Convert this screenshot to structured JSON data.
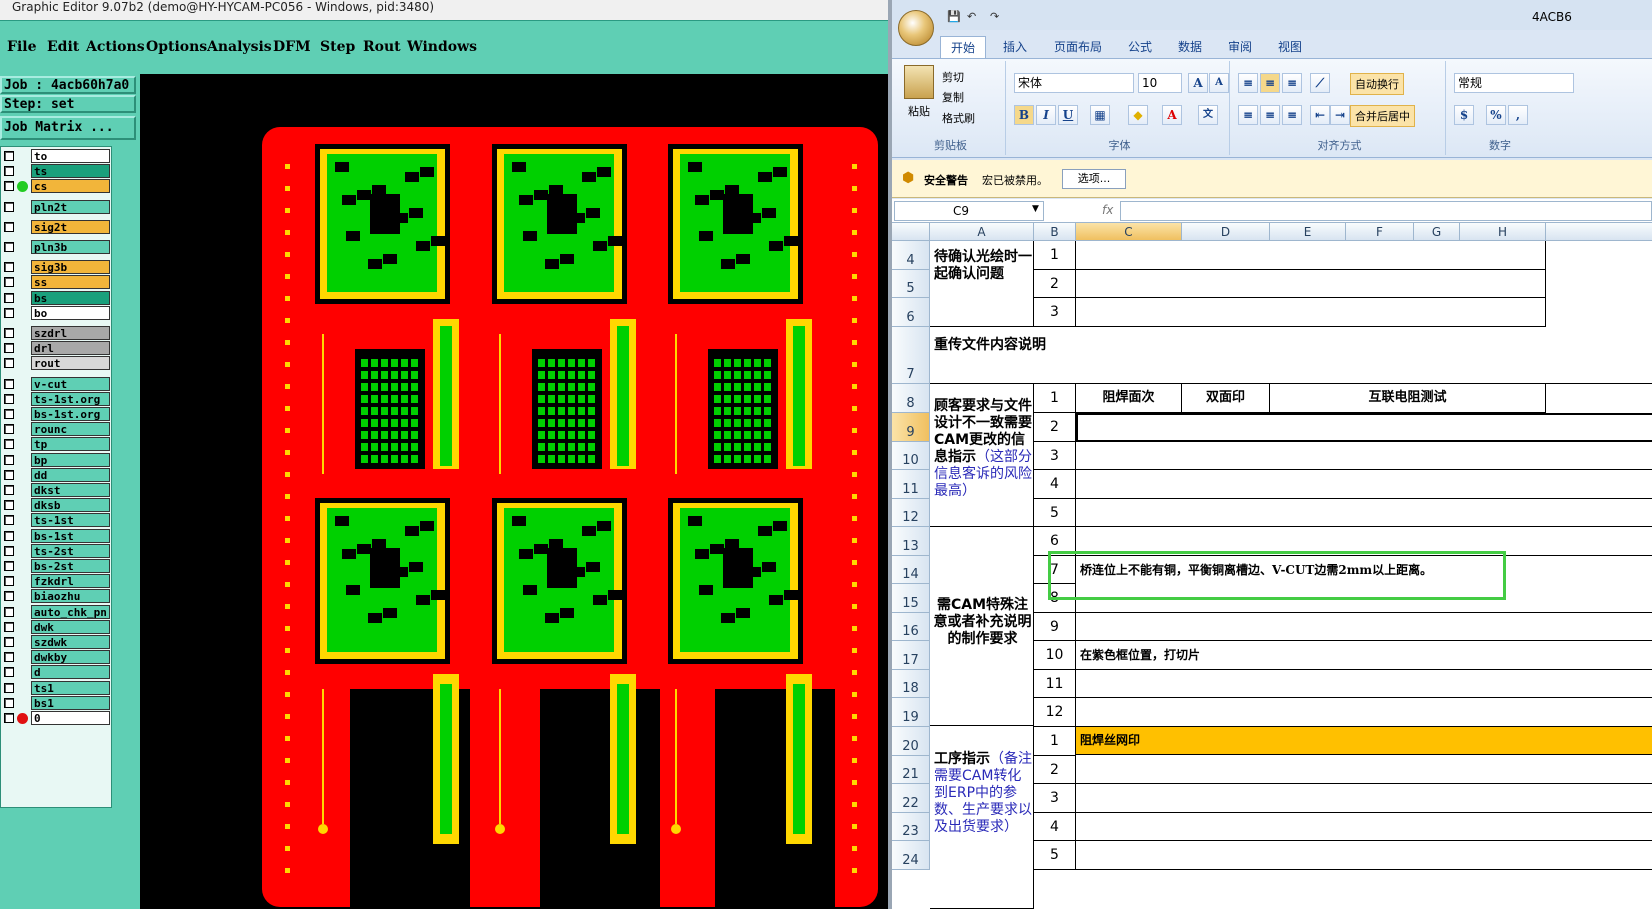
{
  "ge": {
    "title": "Graphic Editor 9.07b2 (demo@HY-HYCAM-PC056 - Windows, pid:3480)",
    "menu": [
      "File",
      "Edit",
      "Actions",
      "Options",
      "Analysis",
      "DFM",
      "Step",
      "Rout",
      "Windows"
    ],
    "job": "Job : 4acb60h7a0",
    "step": "Step: set",
    "matrix": "Job Matrix ...",
    "layers": [
      {
        "name": "to",
        "color": "#ffffff",
        "dot": ""
      },
      {
        "name": "ts",
        "color": "#1aa07c",
        "dot": ""
      },
      {
        "name": "cs",
        "color": "#f2b53a",
        "dot": "#22cc22"
      },
      {
        "name": "pln2t",
        "color": "#5fcfb4",
        "dot": ""
      },
      {
        "name": "sig2t",
        "color": "#f2b53a",
        "dot": ""
      },
      {
        "name": "pln3b",
        "color": "#5fcfb4",
        "dot": ""
      },
      {
        "name": "sig3b",
        "color": "#f2b53a",
        "dot": ""
      },
      {
        "name": "ss",
        "color": "#f2b53a",
        "dot": ""
      },
      {
        "name": "bs",
        "color": "#1aa07c",
        "dot": ""
      },
      {
        "name": "bo",
        "color": "#ffffff",
        "dot": ""
      },
      {
        "name": "szdrl",
        "color": "#a8a8a8",
        "dot": ""
      },
      {
        "name": "drl",
        "color": "#a8a8a8",
        "dot": ""
      },
      {
        "name": "rout",
        "color": "#d8d8d8",
        "dot": ""
      },
      {
        "name": "v-cut",
        "color": "#5fcfb4",
        "dot": ""
      },
      {
        "name": "ts-1st.org",
        "color": "#5fcfb4",
        "dot": ""
      },
      {
        "name": "bs-1st.org",
        "color": "#5fcfb4",
        "dot": ""
      },
      {
        "name": "rounc",
        "color": "#5fcfb4",
        "dot": ""
      },
      {
        "name": "tp",
        "color": "#5fcfb4",
        "dot": ""
      },
      {
        "name": "bp",
        "color": "#5fcfb4",
        "dot": ""
      },
      {
        "name": "dd",
        "color": "#5fcfb4",
        "dot": ""
      },
      {
        "name": "dkst",
        "color": "#5fcfb4",
        "dot": ""
      },
      {
        "name": "dksb",
        "color": "#5fcfb4",
        "dot": ""
      },
      {
        "name": "ts-1st",
        "color": "#5fcfb4",
        "dot": ""
      },
      {
        "name": "bs-1st",
        "color": "#5fcfb4",
        "dot": ""
      },
      {
        "name": "ts-2st",
        "color": "#5fcfb4",
        "dot": ""
      },
      {
        "name": "bs-2st",
        "color": "#5fcfb4",
        "dot": ""
      },
      {
        "name": "fzkdrl",
        "color": "#5fcfb4",
        "dot": ""
      },
      {
        "name": "biaozhu",
        "color": "#5fcfb4",
        "dot": ""
      },
      {
        "name": "auto_chk_pn",
        "color": "#5fcfb4",
        "dot": ""
      },
      {
        "name": "dwk",
        "color": "#5fcfb4",
        "dot": ""
      },
      {
        "name": "szdwk",
        "color": "#5fcfb4",
        "dot": ""
      },
      {
        "name": "dwkby",
        "color": "#5fcfb4",
        "dot": ""
      },
      {
        "name": "d",
        "color": "#5fcfb4",
        "dot": ""
      },
      {
        "name": "ts1",
        "color": "#5fcfb4",
        "dot": ""
      },
      {
        "name": "bs1",
        "color": "#5fcfb4",
        "dot": ""
      },
      {
        "name": "0",
        "color": "#ffffff",
        "dot": "#e01010"
      }
    ]
  },
  "xl": {
    "doc_title": "4ACB6",
    "tabs": [
      "开始",
      "插入",
      "页面布局",
      "公式",
      "数据",
      "审阅",
      "视图"
    ],
    "clipboard": {
      "paste": "粘贴",
      "cut": "剪切",
      "copy": "复制",
      "format_painter": "格式刷",
      "label": "剪贴板"
    },
    "font": {
      "name": "宋体",
      "size": "10",
      "label": "字体",
      "grow": "A",
      "shrink": "A",
      "bold": "B",
      "italic": "I",
      "underline": "U"
    },
    "align": {
      "wrap": "自动换行",
      "merge": "合并后居中",
      "label": "对齐方式"
    },
    "number": {
      "format": "常规",
      "pct": "%",
      "comma": ",",
      "label": "数字"
    },
    "security": {
      "title": "安全警告",
      "msg": "宏已被禁用。",
      "btn": "选项..."
    },
    "name_box": "C9",
    "fx": "fx",
    "columns": [
      "A",
      "B",
      "C",
      "D",
      "E",
      "F",
      "G",
      "H"
    ],
    "rows": [
      "4",
      "5",
      "6",
      "7",
      "8",
      "9",
      "10",
      "11",
      "12",
      "13",
      "14",
      "15",
      "16",
      "17",
      "18",
      "19",
      "20",
      "21",
      "22",
      "23",
      "24"
    ],
    "secA1": "待确认光绘时一起确认问题",
    "secA2": "重传文件内容说明",
    "secA3a": "顾客要求与文件设计不一致需要CAM更改的信息指示",
    "secA3b": "（这部分信息客诉的风险最高）",
    "secA4": "需CAM特殊注意或者补充说明的制作要求",
    "secA5a": "工序指示",
    "secA5b": "（备注需要CAM转化到ERP中的参数、生产要求以及出货要求）",
    "nums1": [
      "1",
      "2",
      "3"
    ],
    "nums3": [
      "1",
      "2",
      "3",
      "4",
      "5"
    ],
    "nums4": [
      "6",
      "7",
      "8",
      "9",
      "10",
      "11",
      "12"
    ],
    "nums5": [
      "1",
      "2",
      "3",
      "4",
      "5"
    ],
    "row8": {
      "c": "阻焊面次",
      "d": "双面印",
      "e": "互联电阻测试"
    },
    "note7": "桥连位上不能有铜，平衡铜离槽边、V-CUT边需2mm以上距离。",
    "note10": "在紫色框位置，打切片",
    "note20": "阻焊丝网印"
  }
}
